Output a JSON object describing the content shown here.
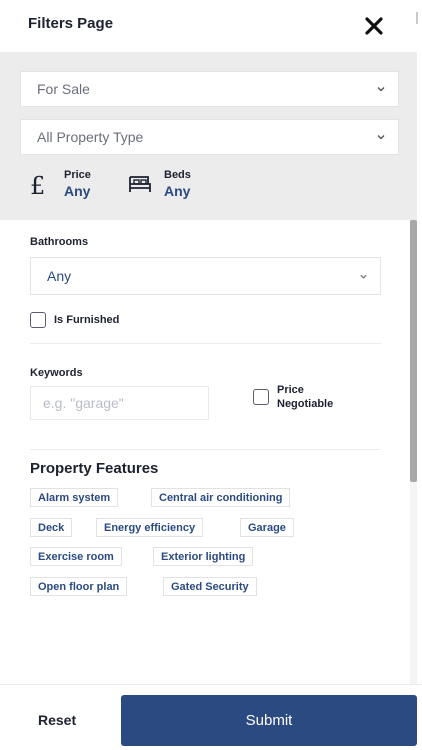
{
  "header": {
    "title": "Filters Page"
  },
  "listing": {
    "selected": "For Sale"
  },
  "property_type": {
    "selected": "All Property Type"
  },
  "quick": {
    "price": {
      "label": "Price",
      "value": "Any"
    },
    "beds": {
      "label": "Beds",
      "value": "Any"
    }
  },
  "bathrooms": {
    "label": "Bathrooms",
    "selected": "Any"
  },
  "furnished": {
    "label": "Is Furnished",
    "checked": false
  },
  "keywords": {
    "label": "Keywords",
    "placeholder": "e.g. \"garage\""
  },
  "negotiable": {
    "line1": "Price",
    "line2": "Negotiable",
    "checked": false
  },
  "features": {
    "title": "Property Features",
    "tags": [
      "Alarm system",
      "Central air conditioning",
      "Deck",
      "Energy efficiency",
      "Garage",
      "Exercise room",
      "Exterior lighting",
      "Open floor plan",
      "Gated Security"
    ]
  },
  "footer": {
    "reset_label": "Reset",
    "submit_label": "Submit"
  },
  "colors": {
    "accent": "#2b4a82",
    "band": "#ececec"
  },
  "icons": [
    "close-icon",
    "chevron-down-icon",
    "pound-icon",
    "bed-icon"
  ]
}
